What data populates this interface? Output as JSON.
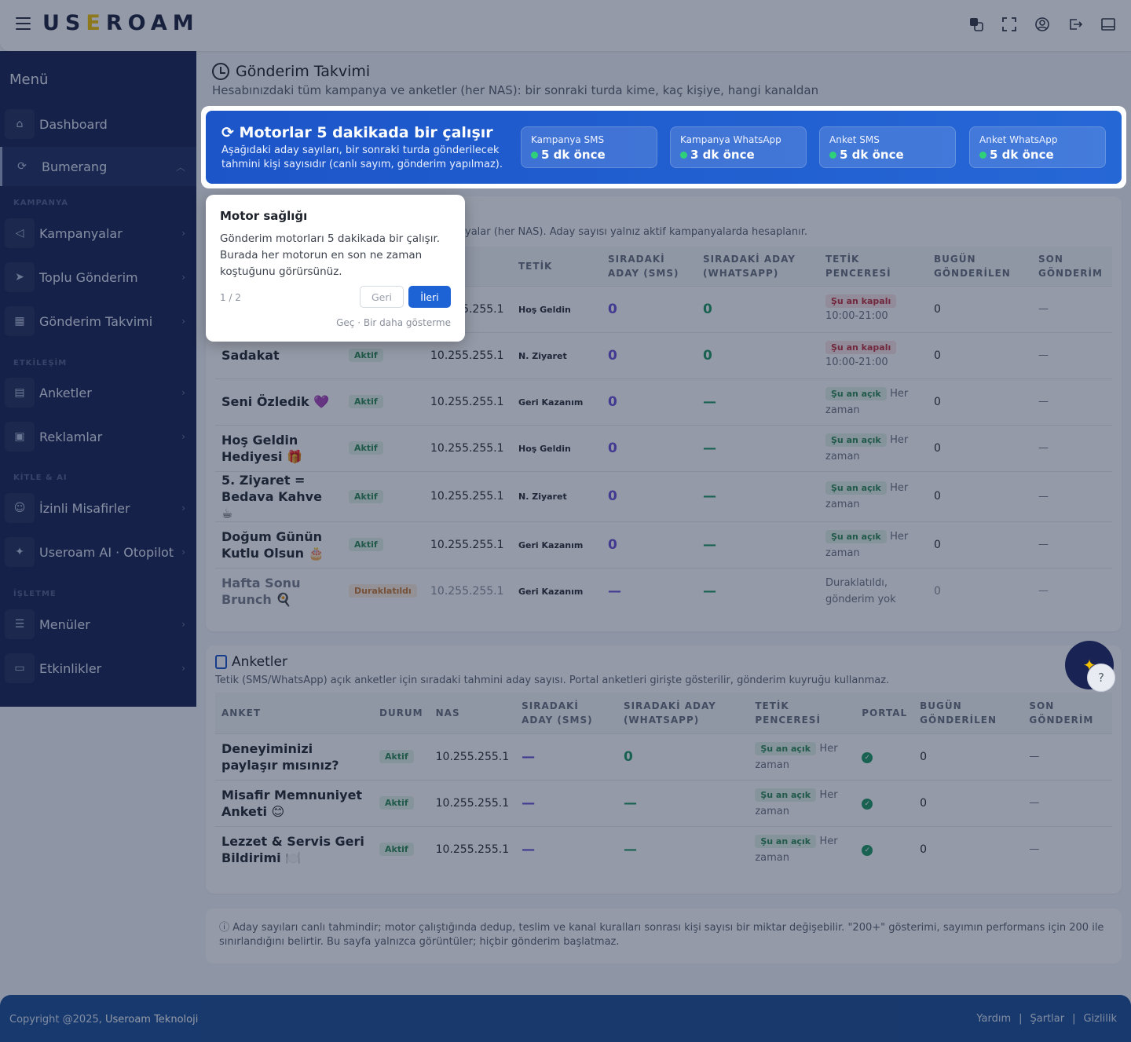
{
  "header": {
    "logo": "USEROAM",
    "icons": [
      "translate-icon",
      "fullscreen-icon",
      "user-icon",
      "logout-icon",
      "panel-icon"
    ]
  },
  "sidebar": {
    "title": "Menü",
    "items": [
      {
        "label": "Dashboard",
        "icon": "home-icon"
      },
      {
        "label": "Bumerang",
        "icon": "refresh-icon"
      },
      {
        "label": "Kampanyalar",
        "icon": "megaphone-icon"
      },
      {
        "label": "Toplu Gönderim",
        "icon": "send-icon"
      },
      {
        "label": "Gönderim Takvimi",
        "icon": "calendar-icon"
      },
      {
        "label": "Anketler",
        "icon": "clipboard-icon"
      },
      {
        "label": "Reklamlar",
        "icon": "ad-icon"
      },
      {
        "label": "İzinli Misafirler",
        "icon": "user-check-icon"
      },
      {
        "label": "Useroam AI · Otopilot",
        "icon": "sparkle-icon"
      },
      {
        "label": "Menüler",
        "icon": "menu-book-icon"
      },
      {
        "label": "Etkinlikler",
        "icon": "event-icon"
      }
    ],
    "sections": [
      "KAMPANYA",
      "ETKİLEŞİM",
      "KİTLE & AI",
      "İŞLETME"
    ]
  },
  "page": {
    "title": "Gönderim Takvimi",
    "subtitle": "Hesabınızdaki tüm kampanya ve anketler (her NAS): bir sonraki turda kime, kaç kişiye, hangi kanaldan"
  },
  "engine": {
    "title": "Motorlar 5 dakikada bir çalışır",
    "desc": "Aşağıdaki aday sayıları, bir sonraki turda gönderilecek tahmini kişi sayısıdır (canlı sayım, gönderim yapılmaz).",
    "cards": [
      {
        "name": "Kampanya SMS",
        "value": "5 dk önce"
      },
      {
        "name": "Kampanya WhatsApp",
        "value": "3 dk önce"
      },
      {
        "name": "Anket SMS",
        "value": "5 dk önce"
      },
      {
        "name": "Anket WhatsApp",
        "value": "5 dk önce"
      }
    ]
  },
  "campaigns": {
    "desc": "yalar (her NAS). Aday sayısı yalnız aktif kampanyalarda hesaplanır.",
    "headers": [
      "TETİK",
      "SIRADAKİ ADAY (SMS)",
      "SIRADAKİ ADAY (WHATSAPP)",
      "TETİK PENCERESİ",
      "BUGÜN GÖNDERİLEN",
      "SON GÖNDERİM"
    ],
    "rows": [
      {
        "name": "",
        "status": "",
        "nas": "10.255.255.1",
        "trigger": "Hoş Geldin",
        "sms": "0",
        "wa": "0",
        "window_badge": "Şu an kapalı",
        "window_text": "10:00-21:00",
        "today": "0",
        "last": "—"
      },
      {
        "name": "Sadakat",
        "status": "Aktif",
        "nas": "10.255.255.1",
        "trigger": "N. Ziyaret",
        "sms": "0",
        "wa": "0",
        "window_badge": "Şu an kapalı",
        "window_text": "10:00-21:00",
        "today": "0",
        "last": "—"
      },
      {
        "name": "Seni Özledik 💜",
        "status": "Aktif",
        "nas": "10.255.255.1",
        "trigger": "Geri Kazanım",
        "sms": "0",
        "wa": "—",
        "window_badge": "Şu an açık",
        "window_text": "Her zaman",
        "today": "0",
        "last": "—"
      },
      {
        "name": "Hoş Geldin Hediyesi 🎁",
        "status": "Aktif",
        "nas": "10.255.255.1",
        "trigger": "Hoş Geldin",
        "sms": "0",
        "wa": "—",
        "window_badge": "Şu an açık",
        "window_text": "Her zaman",
        "today": "0",
        "last": "—"
      },
      {
        "name": "5. Ziyaret = Bedava Kahve ☕",
        "status": "Aktif",
        "nas": "10.255.255.1",
        "trigger": "N. Ziyaret",
        "sms": "0",
        "wa": "—",
        "window_badge": "Şu an açık",
        "window_text": "Her zaman",
        "today": "0",
        "last": "—"
      },
      {
        "name": "Doğum Günün Kutlu Olsun 🎂",
        "status": "Aktif",
        "nas": "10.255.255.1",
        "trigger": "Geri Kazanım",
        "sms": "0",
        "wa": "—",
        "window_badge": "Şu an açık",
        "window_text": "Her zaman",
        "today": "0",
        "last": "—"
      },
      {
        "name": "Hafta Sonu Brunch 🍳",
        "status": "Duraklatıldı",
        "nas": "10.255.255.1",
        "trigger": "Geri Kazanım",
        "sms": "—",
        "wa": "—",
        "window_badge": "",
        "window_text": "Duraklatıldı, gönderim yok",
        "today": "0",
        "last": "—"
      }
    ]
  },
  "surveys": {
    "title": "Anketler",
    "desc": "Tetik (SMS/WhatsApp) açık anketler için sıradaki tahmini aday sayısı. Portal anketleri girişte gösterilir, gönderim kuyruğu kullanmaz.",
    "headers": [
      "ANKET",
      "DURUM",
      "NAS",
      "SIRADAKİ ADAY (SMS)",
      "SIRADAKİ ADAY (WHATSAPP)",
      "TETİK PENCERESİ",
      "PORTAL",
      "BUGÜN GÖNDERİLEN",
      "SON GÖNDERİM"
    ],
    "rows": [
      {
        "name": "Deneyiminizi paylaşır mısınız?",
        "status": "Aktif",
        "nas": "10.255.255.1",
        "sms": "—",
        "wa": "0",
        "window_badge": "Şu an açık",
        "window_text": "Her zaman",
        "today": "0",
        "last": "—"
      },
      {
        "name": "Misafir Memnuniyet Anketi 😊",
        "status": "Aktif",
        "nas": "10.255.255.1",
        "sms": "—",
        "wa": "—",
        "window_badge": "Şu an açık",
        "window_text": "Her zaman",
        "today": "0",
        "last": "—"
      },
      {
        "name": "Lezzet & Servis Geri Bildirimi 🍽️",
        "status": "Aktif",
        "nas": "10.255.255.1",
        "sms": "—",
        "wa": "—",
        "window_badge": "Şu an açık",
        "window_text": "Her zaman",
        "today": "0",
        "last": "—"
      }
    ]
  },
  "info": "ⓘ Aday sayıları canlı tahmindir; motor çalıştığında dedup, teslim ve kanal kuralları sonrası kişi sayısı bir miktar değişebilir. \"200+\" gösterimi, sayımın performans için 200 ile sınırlandığını belirtir. Bu sayfa yalnızca görüntüler; hiçbir gönderim başlatmaz.",
  "tour": {
    "title": "Motor sağlığı",
    "body": "Gönderim motorları 5 dakikada bir çalışır. Burada her motorun en son ne zaman koştuğunu görürsünüz.",
    "step": "1 / 2",
    "back": "Geri",
    "next": "İleri",
    "skip": "Geç · Bir daha gösterme"
  },
  "footer": {
    "copyright": "Copyright @2025,",
    "company": "Useroam Teknoloji",
    "links": [
      "Yardım",
      "Şartlar",
      "Gizlilik"
    ]
  },
  "fab": {
    "help": "?"
  }
}
